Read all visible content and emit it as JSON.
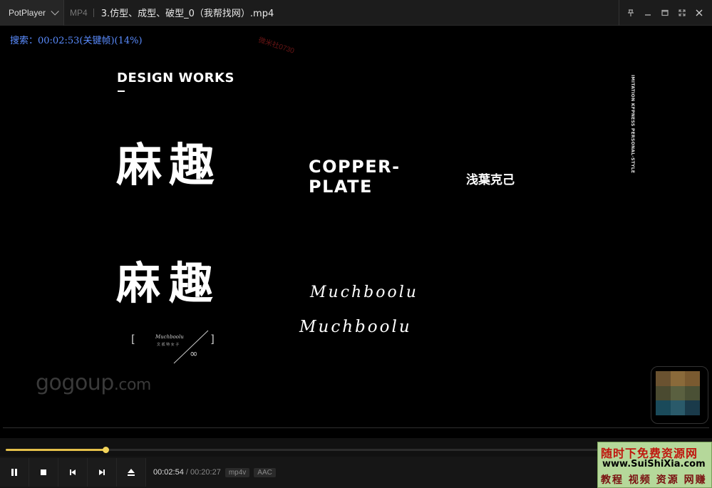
{
  "titlebar": {
    "app": "PotPlayer",
    "format": "MP4",
    "filename": "3.仿型、成型、破型_0（我帮找网）.mp4"
  },
  "osd": {
    "seek_text": "搜索：00:02:53(关键帧)(14%)"
  },
  "video": {
    "stamp": "微米社0730",
    "design_works": "DESIGN WORKS",
    "vertical_text": "IMITATION KFPNESS PERSONAL-STYLE",
    "maqu_1": "麻趣",
    "maqu_2": "麻趣",
    "copperplate_l1": "COPPER-",
    "copperplate_l2": "PLATE",
    "qianye": "浅葉克己",
    "muchboolu_1": "Muchboolu",
    "muchboolu_2": "Muchboolu",
    "bracket_l": "[",
    "bracket_r": "]",
    "mini_title": "Muchboolu",
    "mini_sub": "文 孤 特 女 子",
    "infinity": "∞",
    "watermark": "gogoup",
    "watermark_suffix": ".com"
  },
  "playback": {
    "progress": 0.1417,
    "current": "00:02:54",
    "divider": " / ",
    "total": "00:20:27",
    "video_codec": "mp4v",
    "audio_codec": "AAC"
  },
  "site_watermark": {
    "line1": "随时下免费资源网",
    "line2": "www.SuiShiXia.com",
    "line3": "教程 视频 资源 网赚"
  },
  "colors": {
    "accent": "#e5c04a",
    "osd": "#5a8cff"
  }
}
